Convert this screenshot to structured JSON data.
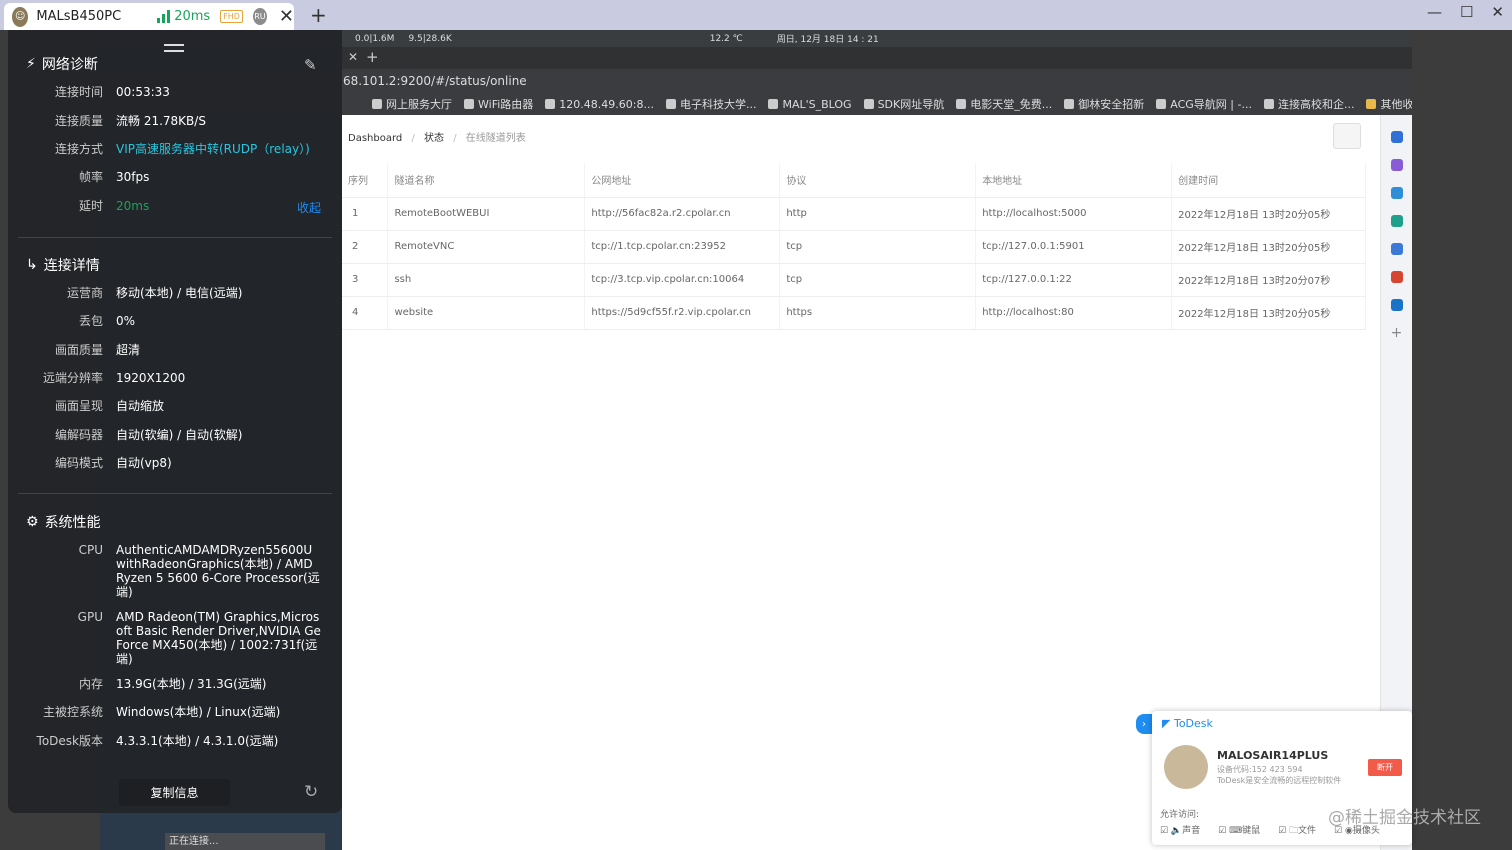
{
  "titlebar": {
    "device_name": "MALsB450PC",
    "latency": "20ms",
    "fhd_badge": "FHD",
    "ru_badge": "RU"
  },
  "remote_taskbar": {
    "net": "0.0|1.6M",
    "net2": "9.5|28.6K",
    "temp": "12.2 ℃",
    "datetime": "周日, 12月 18日 14 : 21"
  },
  "browser": {
    "address": "68.101.2:9200/#/status/online",
    "bookmarks": [
      "网上服务大厅",
      "WiFi路由器",
      "120.48.49.60:8...",
      "电子科技大学...",
      "MAL'S_BLOG",
      "SDK网址导航",
      "电影天堂_免费...",
      "御林安全招新",
      "ACG导航网 | -...",
      "连接高校和企...",
      "其他收藏夹"
    ],
    "breadcrumb": {
      "home": "Dashboard",
      "sep": "/",
      "status": "状态",
      "current": "在线隧道列表"
    },
    "table": {
      "headers": [
        "序列",
        "隧道名称",
        "公网地址",
        "协议",
        "本地地址",
        "创建时间"
      ],
      "rows": [
        [
          "1",
          "RemoteBootWEBUI",
          "http://56fac82a.r2.cpolar.cn",
          "http",
          "http://localhost:5000",
          "2022年12月18日 13时20分05秒"
        ],
        [
          "2",
          "RemoteVNC",
          "tcp://1.tcp.cpolar.cn:23952",
          "tcp",
          "tcp://127.0.0.1:5901",
          "2022年12月18日 13时20分05秒"
        ],
        [
          "3",
          "ssh",
          "tcp://3.tcp.vip.cpolar.cn:10064",
          "tcp",
          "tcp://127.0.0.1:22",
          "2022年12月18日 13时20分07秒"
        ],
        [
          "4",
          "website",
          "https://5d9cf55f.r2.vip.cpolar.cn",
          "https",
          "http://localhost:80",
          "2022年12月18日 13时20分05秒"
        ]
      ]
    }
  },
  "panel": {
    "network_title": "网络诊断",
    "collapse_label": "收起",
    "network": [
      {
        "k": "连接时间",
        "v": "00:53:33"
      },
      {
        "k": "连接质量",
        "v": "流畅 21.78KB/S"
      },
      {
        "k": "连接方式",
        "v": "VIP高速服务器中转(RUDP（relay）)"
      },
      {
        "k": "帧率",
        "v": "30fps"
      },
      {
        "k": "延时",
        "v": "20ms"
      }
    ],
    "detail_title": "连接详情",
    "details": [
      {
        "k": "运营商",
        "v": "移动(本地) / 电信(远端)"
      },
      {
        "k": "丢包",
        "v": "0%"
      },
      {
        "k": "画面质量",
        "v": "超清"
      },
      {
        "k": "远端分辨率",
        "v": "1920X1200"
      },
      {
        "k": "画面呈现",
        "v": "自动缩放"
      },
      {
        "k": "编解码器",
        "v": "自动(软编) / 自动(软解)"
      },
      {
        "k": "编码模式",
        "v": "自动(vp8)"
      }
    ],
    "perf_title": "系统性能",
    "perf": [
      {
        "k": "CPU",
        "v": "AuthenticAMDAMDRyzen55600UwithRadeonGraphics(本地) / AMD Ryzen 5 5600 6-Core Processor(远端)"
      },
      {
        "k": "GPU",
        "v": "AMD Radeon(TM) Graphics,Microsoft Basic Render Driver,NVIDIA GeForce MX450(本地) / 1002:731f(远端)"
      },
      {
        "k": "内存",
        "v": "13.9G(本地) / 31.3G(远端)"
      },
      {
        "k": "主被控系统",
        "v": "Windows(本地) / Linux(远端)"
      },
      {
        "k": "ToDesk版本",
        "v": "4.3.3.1(本地) / 4.3.1.0(远端)"
      }
    ],
    "copy_button": "复制信息",
    "connecting": "正在连接..."
  },
  "todesk_card": {
    "brand": "ToDesk",
    "device": "MALOSAIR14PLUS",
    "code": "设备代码:152 423 594",
    "desc": "ToDesk是安全流畅的远程控制软件",
    "disconnect": "断开",
    "allow_label": "允许访问:",
    "perms": [
      "声音",
      "键鼠",
      "文件",
      "摄像头"
    ]
  },
  "watermark": "@稀土掘金技术社区",
  "colors": {
    "accent": "#1e8cf0",
    "latency_green": "#1aa35a",
    "vip_cyan": "#29c6e0"
  }
}
